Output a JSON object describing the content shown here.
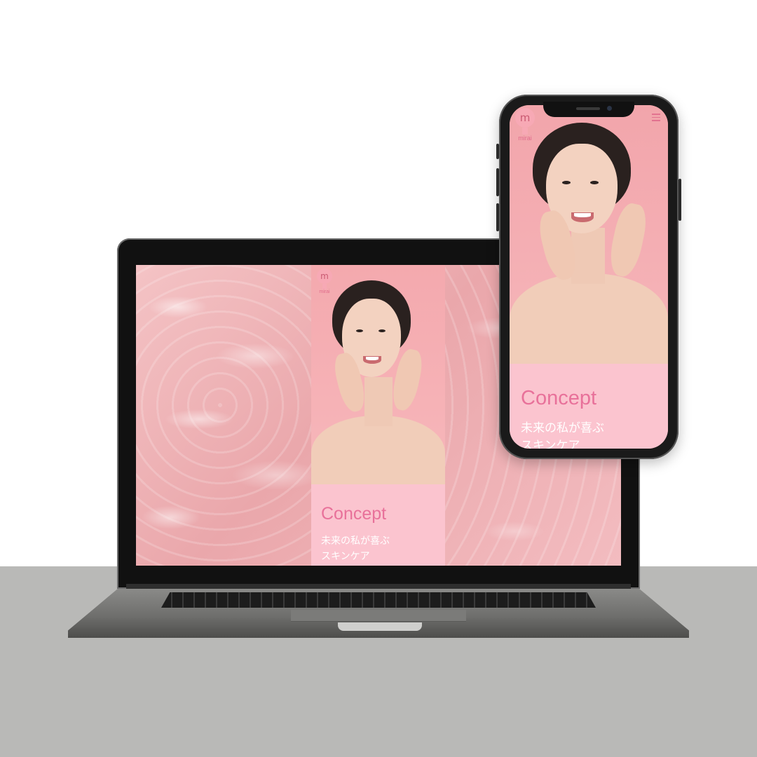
{
  "site": {
    "logo_letter": "m",
    "logo_word": "mirai",
    "concept_title": "Concept",
    "concept_line1": "未来の私が喜ぶ",
    "concept_line2": "スキンケア",
    "menu_icon": "hamburger-menu-icon"
  },
  "colors": {
    "accent": "#e8719a",
    "hero_pink": "#f4a9ae",
    "concept_bg": "#fbc4cf",
    "table": "#b9b9b7"
  }
}
